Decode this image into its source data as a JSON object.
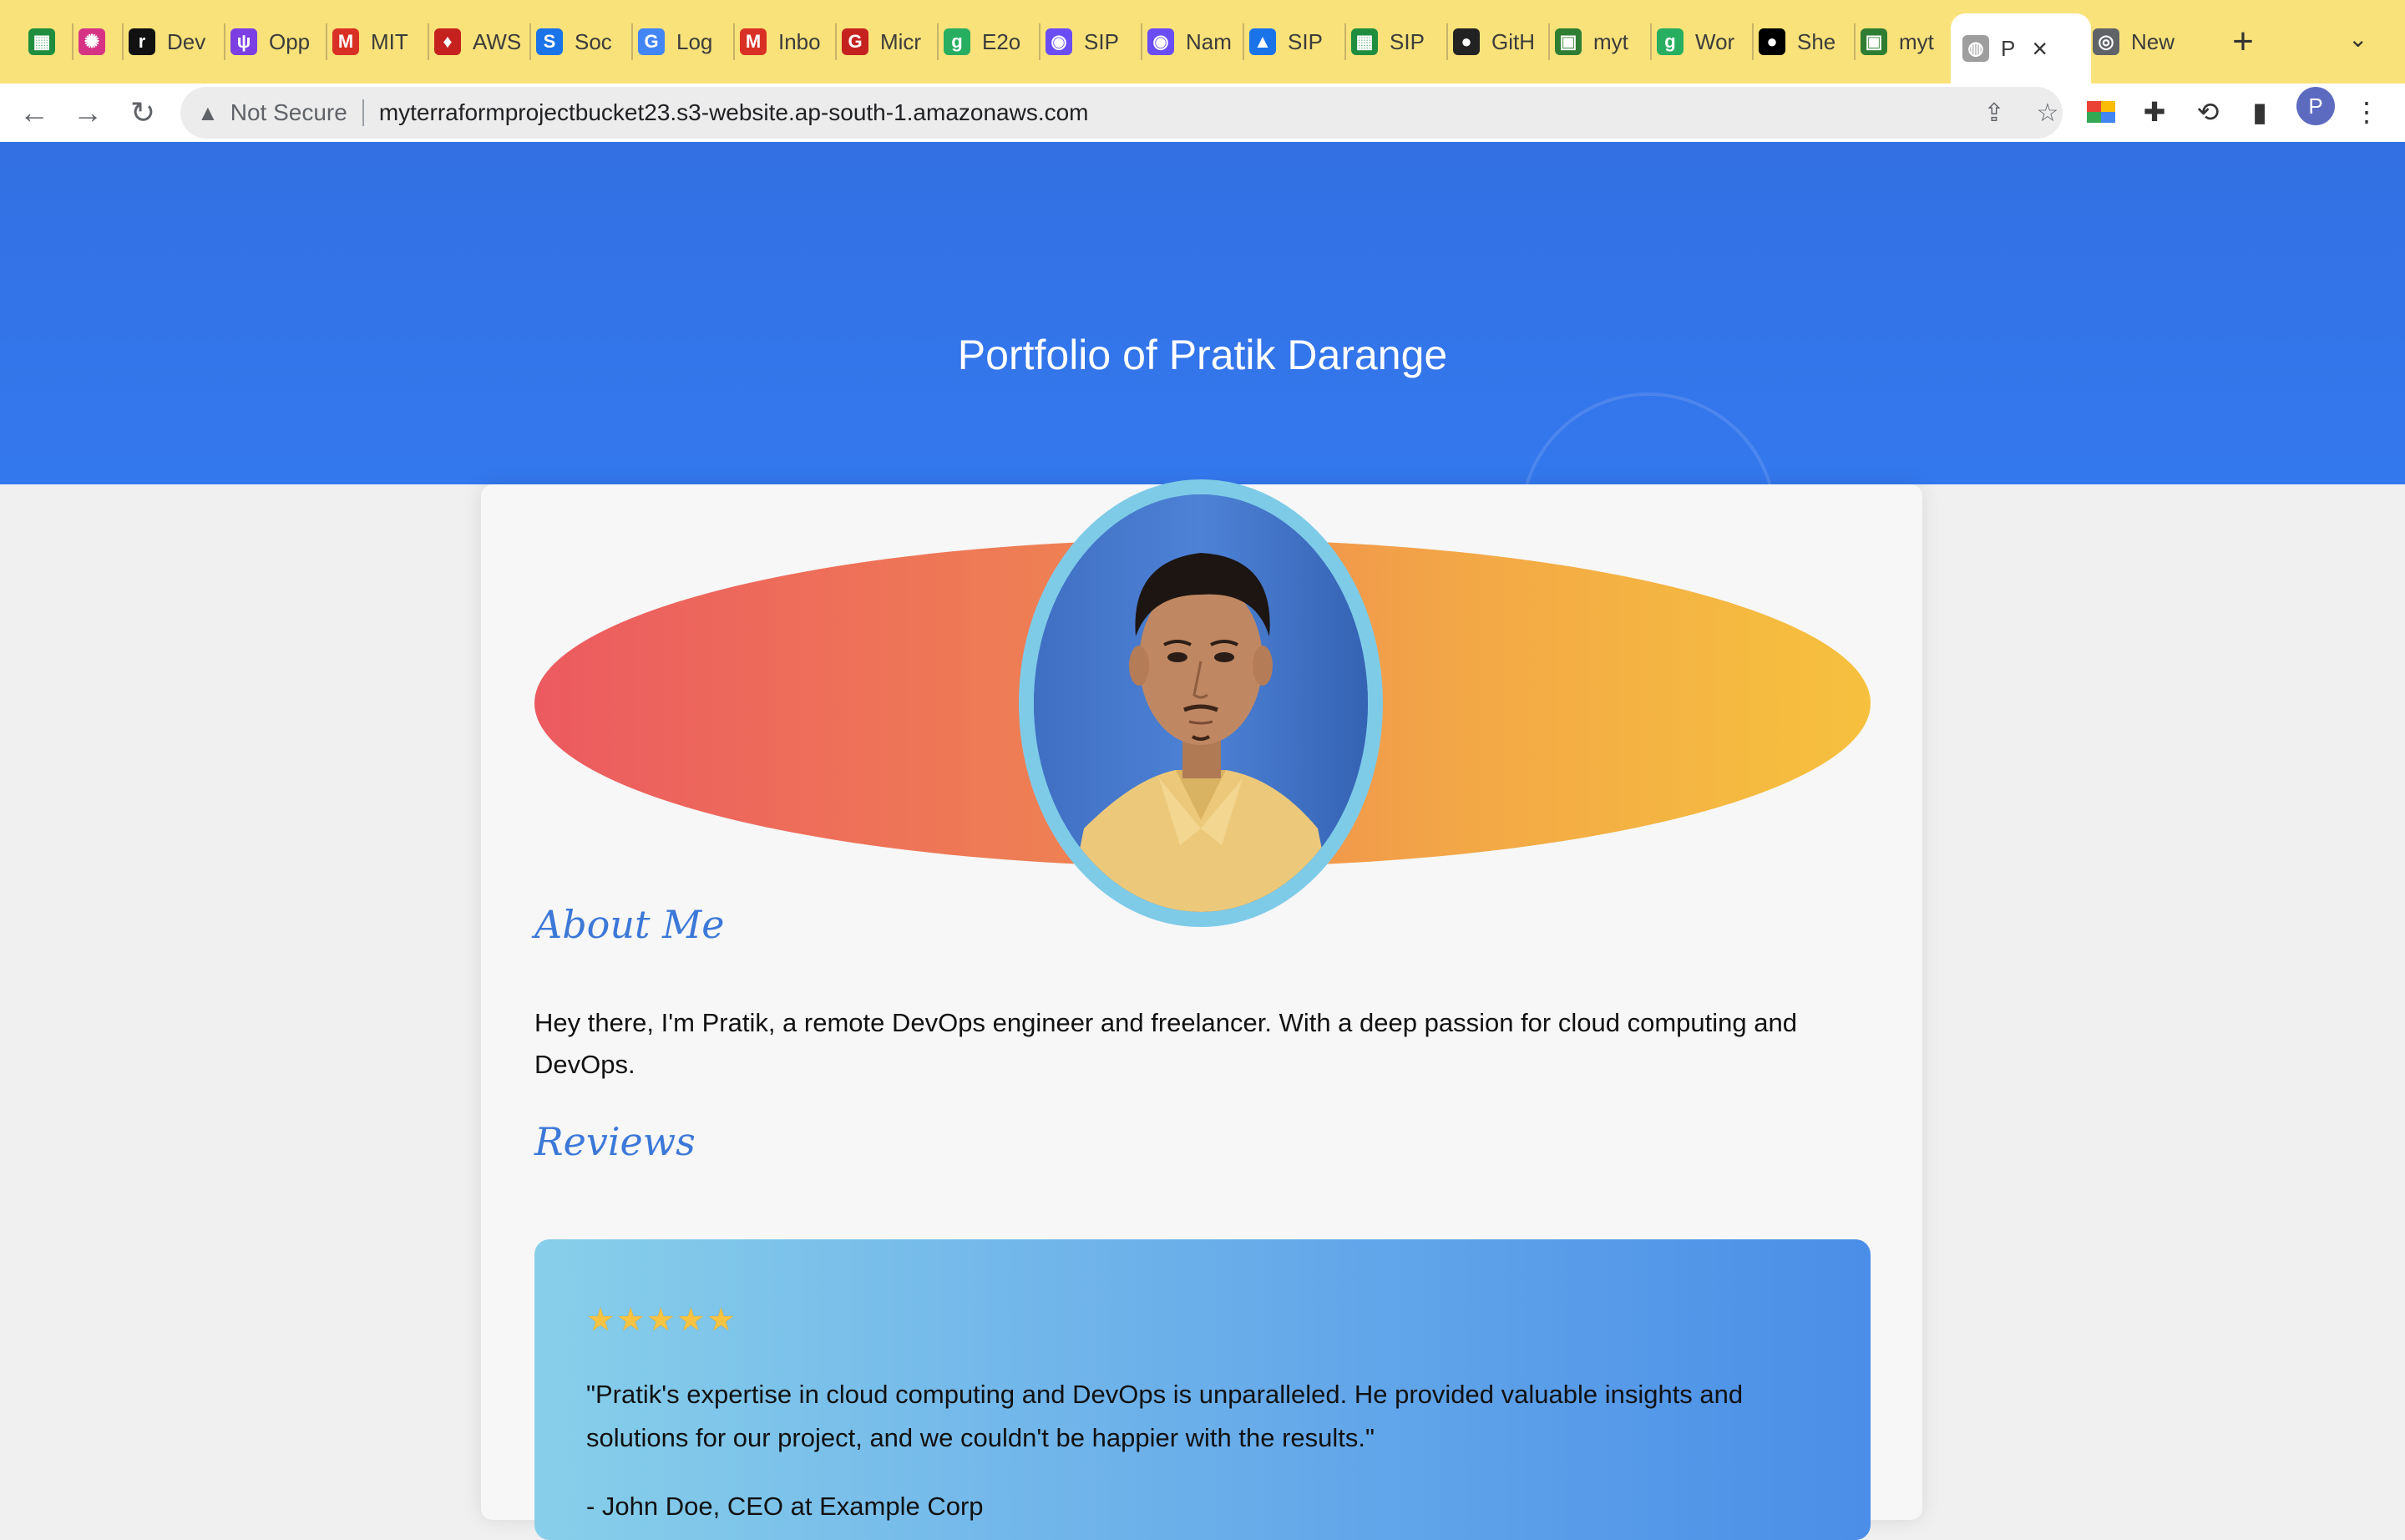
{
  "browser": {
    "tabs": [
      {
        "title": "",
        "icon": "sheets-icon",
        "color": "#1e8e3e"
      },
      {
        "title": "",
        "icon": "grid-icon",
        "color": "#d63384"
      },
      {
        "title": "Dev",
        "icon": "dev-icon",
        "color": "#111111"
      },
      {
        "title": "Opp",
        "icon": "opp-icon",
        "color": "#7b3fe4"
      },
      {
        "title": "MIT",
        "icon": "gmail-icon",
        "color": "#d93025"
      },
      {
        "title": "AWS",
        "icon": "aws-icon",
        "color": "#c5221f"
      },
      {
        "title": "Soc",
        "icon": "s-icon",
        "color": "#1a73e8"
      },
      {
        "title": "Log",
        "icon": "google-icon",
        "color": "#4285f4"
      },
      {
        "title": "Inbo",
        "icon": "gmail-icon",
        "color": "#d93025"
      },
      {
        "title": "Micr",
        "icon": "g-icon",
        "color": "#c5221f"
      },
      {
        "title": "E2o",
        "icon": "grammar-icon",
        "color": "#27ae60"
      },
      {
        "title": "SIP",
        "icon": "brain-icon",
        "color": "#6a4df5"
      },
      {
        "title": "Nam",
        "icon": "brain-icon",
        "color": "#6a4df5"
      },
      {
        "title": "SIP",
        "icon": "drive-icon",
        "color": "#1a73e8"
      },
      {
        "title": "SIP",
        "icon": "sheets-icon",
        "color": "#1e8e3e"
      },
      {
        "title": "GitH",
        "icon": "github-icon",
        "color": "#222222"
      },
      {
        "title": "myt",
        "icon": "terraform-icon",
        "color": "#2e7d32"
      },
      {
        "title": "Wor",
        "icon": "grammar-icon",
        "color": "#27ae60"
      },
      {
        "title": "She",
        "icon": "medium-icon",
        "color": "#000000"
      },
      {
        "title": "myt",
        "icon": "terraform-icon",
        "color": "#2e7d32"
      },
      {
        "title": "P",
        "icon": "globe-icon",
        "color": "#9e9e9e",
        "active": true
      },
      {
        "title": "New",
        "icon": "chrome-icon",
        "color": "#5f6368"
      }
    ],
    "security_label": "Not Secure",
    "url": "myterraformprojectbucket23.s3-website.ap-south-1.amazonaws.com",
    "profile_initial": "P"
  },
  "page": {
    "hero_title": "Portfolio of Pratik Darange",
    "about_heading": "About Me",
    "about_text": "Hey there, I'm Pratik, a remote DevOps engineer and freelancer. With a deep passion for cloud computing and DevOps.",
    "reviews_heading": "Reviews",
    "review": {
      "stars": 5,
      "text": "\"Pratik's expertise in cloud computing and DevOps is unparalleled. He provided valuable insights and solutions for our project, and we couldn't be happier with the results.\"",
      "author": "- John Doe, CEO at Example Corp"
    }
  },
  "colors": {
    "hero": "#3270e3",
    "heading": "#3c78d8",
    "tabbar": "#f9e27a",
    "photo_ring": "#7ecbe8"
  }
}
